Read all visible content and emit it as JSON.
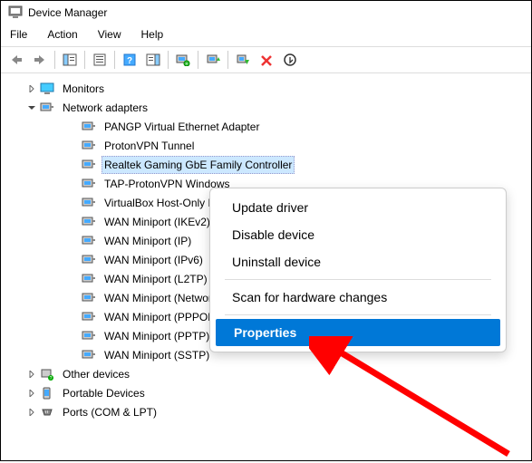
{
  "window": {
    "title": "Device Manager"
  },
  "menu": {
    "file": "File",
    "action": "Action",
    "view": "View",
    "help": "Help"
  },
  "tree": {
    "monitors": "Monitors",
    "network_adapters": "Network adapters",
    "adapters": [
      "PANGP Virtual Ethernet Adapter",
      "ProtonVPN Tunnel",
      "Realtek Gaming GbE Family Controller",
      "TAP-ProtonVPN Windows",
      "VirtualBox Host-Only Eth",
      "WAN Miniport (IKEv2)",
      "WAN Miniport (IP)",
      "WAN Miniport (IPv6)",
      "WAN Miniport (L2TP)",
      "WAN Miniport (Network",
      "WAN Miniport (PPPOE)",
      "WAN Miniport (PPTP)",
      "WAN Miniport (SSTP)"
    ],
    "other_devices": "Other devices",
    "portable_devices": "Portable Devices",
    "ports": "Ports (COM & LPT)"
  },
  "context": {
    "update": "Update driver",
    "disable": "Disable device",
    "uninstall": "Uninstall device",
    "scan": "Scan for hardware changes",
    "properties": "Properties"
  }
}
